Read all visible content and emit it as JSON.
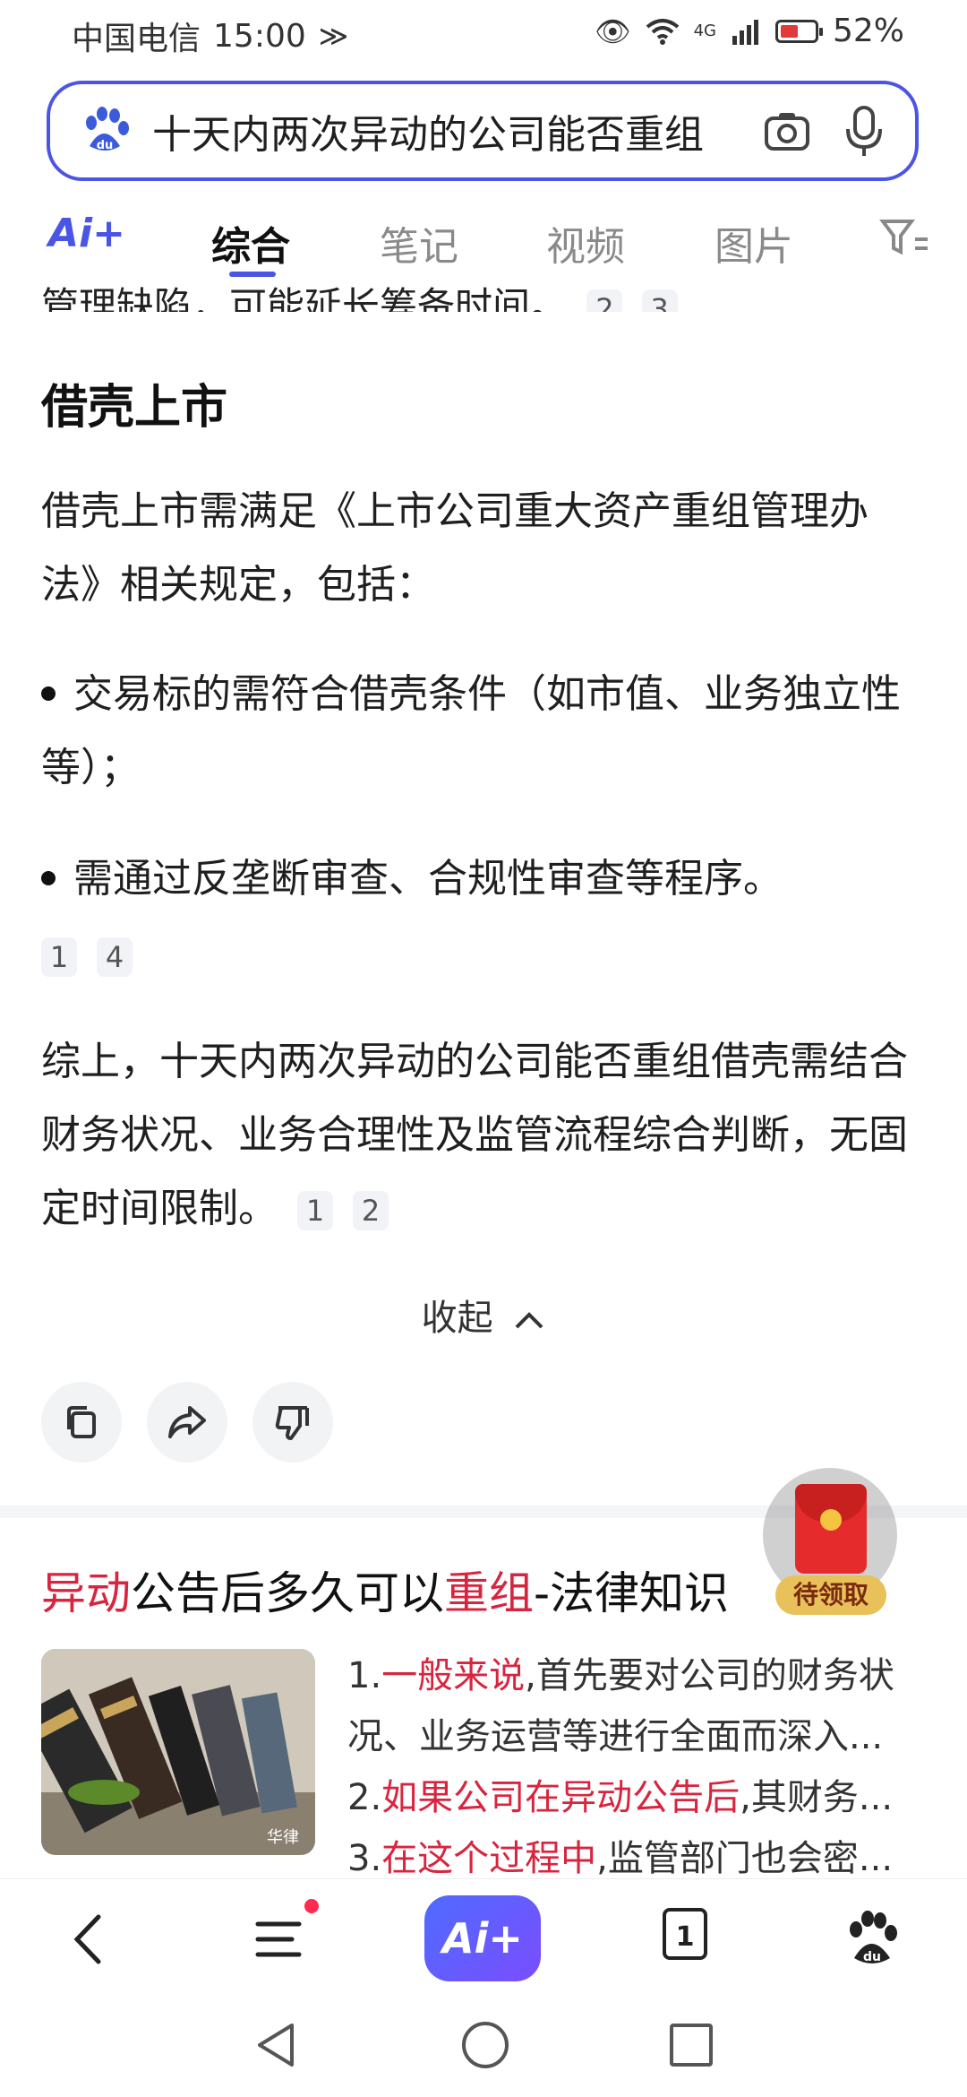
{
  "status_bar": {
    "carrier": "中国电信",
    "time": "15:00",
    "network": "4G",
    "battery": "52%",
    "battery_level": 0.52,
    "battery_color": "#e23a3a"
  },
  "search": {
    "query": "十天内两次异动的公司能否重组"
  },
  "tabs": {
    "ai_label": "Ai+",
    "items": [
      "综合",
      "笔记",
      "视频",
      "图片"
    ],
    "active": "综合",
    "accent_color": "#4a55e6"
  },
  "content": {
    "cut_line": "管理缺陷，可能延长筹备时间。",
    "cut_line_cites": [
      "2",
      "3"
    ],
    "section_title": "借壳上市",
    "para1": "借壳上市需满足《上市公司重大资产重组管理办法》相关规定，包括：",
    "bullet1": "交易标的需符合借壳条件（如市值、业务独立性等）；",
    "bullet2": "需通过反垄断审查、合规性审查等程序。",
    "bullet2_cites": [
      "1",
      "4"
    ],
    "summary": "综上，十天内两次异动的公司能否重组借壳需结合财务状况、业务合理性及监管流程综合判断，无固定时间限制。",
    "summary_cites": [
      "1",
      "2"
    ],
    "collapse_label": "收起"
  },
  "actions": [
    "copy-icon",
    "share-icon",
    "dislike-icon"
  ],
  "result": {
    "title_parts": [
      {
        "text": "异动",
        "hl": true
      },
      {
        "text": "公告后多久可以",
        "hl": false
      },
      {
        "text": "重组",
        "hl": true
      },
      {
        "text": "-法律知识",
        "hl": false
      }
    ],
    "image_caption": "华律",
    "lines": [
      {
        "prefix": "1.",
        "hl": "一般来说",
        "rest": ",首先要对公司的财务状"
      },
      {
        "prefix": "",
        "hl": "",
        "rest": "况、业务运营等进行全面而深入..."
      },
      {
        "prefix": "2.",
        "hl": "如果公司在异动公告后",
        "rest": ",其财务..."
      },
      {
        "prefix": "3.",
        "hl": "在这个过程中",
        "rest": ",监管部门也会密..."
      }
    ],
    "highlight_color": "#d8253f"
  },
  "red_packet": {
    "label": "待领取"
  },
  "bottom_nav": {
    "ai_label": "Ai+",
    "tab_count": "1"
  }
}
